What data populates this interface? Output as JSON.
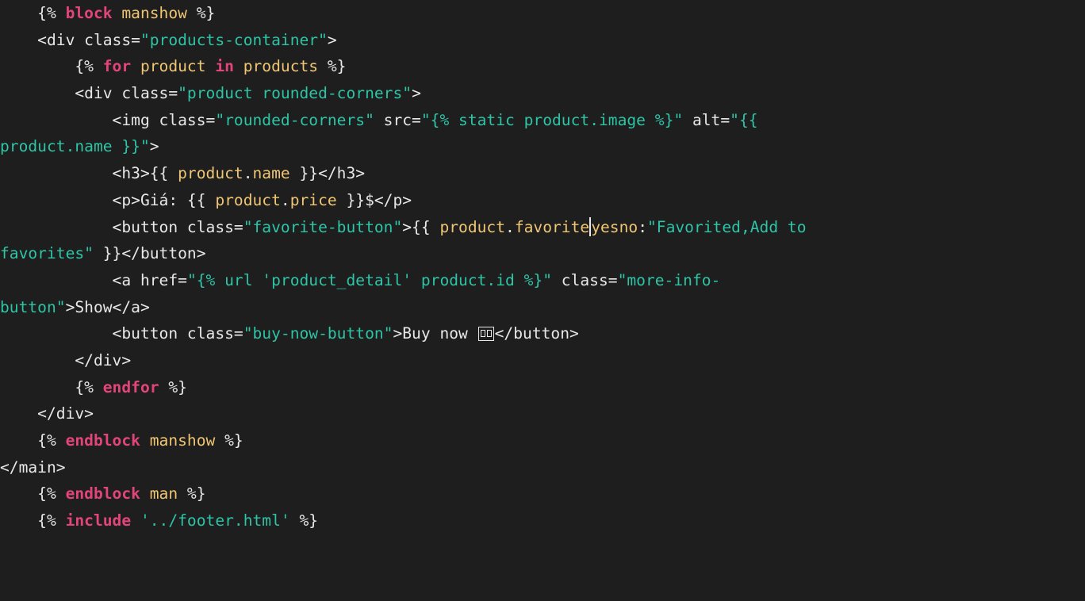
{
  "editor": {
    "theme_colors": {
      "background": "#1e1e1e",
      "text": "#e8e8e8",
      "keyword": "#e2457a",
      "variable": "#f0c674",
      "string": "#2ec4a6"
    },
    "lines": [
      [
        {
          "c": "plain",
          "t": "    {% "
        },
        {
          "c": "keyword",
          "t": "block"
        },
        {
          "c": "plain",
          "t": " "
        },
        {
          "c": "var",
          "t": "manshow"
        },
        {
          "c": "plain",
          "t": " %}"
        }
      ],
      [
        {
          "c": "plain",
          "t": "    <div class="
        },
        {
          "c": "string",
          "t": "\"products-container\""
        },
        {
          "c": "plain",
          "t": ">"
        }
      ],
      [
        {
          "c": "plain",
          "t": "        {% "
        },
        {
          "c": "keyword",
          "t": "for"
        },
        {
          "c": "plain",
          "t": " "
        },
        {
          "c": "var",
          "t": "product"
        },
        {
          "c": "plain",
          "t": " "
        },
        {
          "c": "keyword",
          "t": "in"
        },
        {
          "c": "plain",
          "t": " "
        },
        {
          "c": "var",
          "t": "products"
        },
        {
          "c": "plain",
          "t": " %}"
        }
      ],
      [
        {
          "c": "plain",
          "t": "        <div class="
        },
        {
          "c": "string",
          "t": "\"product rounded-corners\""
        },
        {
          "c": "plain",
          "t": ">"
        }
      ],
      [
        {
          "c": "plain",
          "t": "            <img class="
        },
        {
          "c": "string",
          "t": "\"rounded-corners\""
        },
        {
          "c": "plain",
          "t": " src="
        },
        {
          "c": "string",
          "t": "\"{% static product.image %}\""
        },
        {
          "c": "plain",
          "t": " alt="
        },
        {
          "c": "string",
          "t": "\"{{"
        }
      ],
      [
        {
          "c": "string",
          "t": "product.name }}\""
        },
        {
          "c": "plain",
          "t": ">"
        }
      ],
      [
        {
          "c": "plain",
          "t": "            <h3>{{ "
        },
        {
          "c": "var",
          "t": "product"
        },
        {
          "c": "plain",
          "t": "."
        },
        {
          "c": "var",
          "t": "name"
        },
        {
          "c": "plain",
          "t": " }}</h3>"
        }
      ],
      [
        {
          "c": "plain",
          "t": "            <p>Giá: {{ "
        },
        {
          "c": "var",
          "t": "product"
        },
        {
          "c": "plain",
          "t": "."
        },
        {
          "c": "var",
          "t": "price"
        },
        {
          "c": "plain",
          "t": " }}$</p>"
        }
      ],
      [
        {
          "c": "plain",
          "t": "            <button class="
        },
        {
          "c": "string",
          "t": "\"favorite-button\""
        },
        {
          "c": "plain",
          "t": ">{{ "
        },
        {
          "c": "var",
          "t": "product"
        },
        {
          "c": "plain",
          "t": "."
        },
        {
          "c": "var",
          "t": "favorite"
        },
        {
          "c": "cursor",
          "t": ""
        },
        {
          "c": "var",
          "t": "yesno"
        },
        {
          "c": "plain",
          "t": ":"
        },
        {
          "c": "string",
          "t": "\"Favorited,Add to"
        }
      ],
      [
        {
          "c": "string",
          "t": "favorites\""
        },
        {
          "c": "plain",
          "t": " }}</button>"
        }
      ],
      [
        {
          "c": "plain",
          "t": "            <a href="
        },
        {
          "c": "string",
          "t": "\"{% url 'product_detail' product.id %}\""
        },
        {
          "c": "plain",
          "t": " class="
        },
        {
          "c": "string",
          "t": "\"more-info-"
        }
      ],
      [
        {
          "c": "string",
          "t": "button\""
        },
        {
          "c": "plain",
          "t": ">Show</a>"
        }
      ],
      [
        {
          "c": "plain",
          "t": "            <button class="
        },
        {
          "c": "string",
          "t": "\"buy-now-button\""
        },
        {
          "c": "plain",
          "t": ">Buy now "
        },
        {
          "c": "emoji",
          "t": ""
        },
        {
          "c": "plain",
          "t": "</button>"
        }
      ],
      [
        {
          "c": "plain",
          "t": "        </div>"
        }
      ],
      [
        {
          "c": "plain",
          "t": "        {% "
        },
        {
          "c": "keyword",
          "t": "endfor"
        },
        {
          "c": "plain",
          "t": " %}"
        }
      ],
      [
        {
          "c": "plain",
          "t": "    </div>"
        }
      ],
      [
        {
          "c": "plain",
          "t": "    {% "
        },
        {
          "c": "keyword",
          "t": "endblock"
        },
        {
          "c": "plain",
          "t": " "
        },
        {
          "c": "var",
          "t": "manshow"
        },
        {
          "c": "plain",
          "t": " %}"
        }
      ],
      [
        {
          "c": "plain",
          "t": "</main>"
        }
      ],
      [
        {
          "c": "plain",
          "t": "    {% "
        },
        {
          "c": "keyword",
          "t": "endblock"
        },
        {
          "c": "plain",
          "t": " "
        },
        {
          "c": "var",
          "t": "man"
        },
        {
          "c": "plain",
          "t": " %}"
        }
      ],
      [
        {
          "c": "plain",
          "t": "    {% "
        },
        {
          "c": "keyword",
          "t": "include"
        },
        {
          "c": "plain",
          "t": " "
        },
        {
          "c": "string",
          "t": "'../footer.html'"
        },
        {
          "c": "plain",
          "t": " %}"
        }
      ]
    ]
  }
}
